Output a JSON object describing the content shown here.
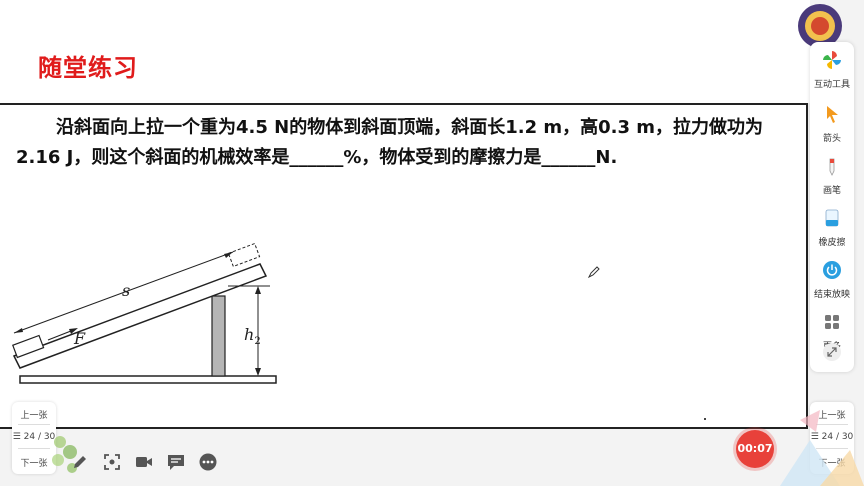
{
  "slide": {
    "title": "随堂练习",
    "problem_text": "沿斜面向上拉一个重为4.5 N的物体到斜面顶端，斜面长1.2 m，高0.3 m，拉力做功为2.16 J，则这个斜面的机械效率是______%，物体受到的摩擦力是______N.",
    "diagram": {
      "label_s": "s",
      "label_F": "F",
      "label_h": "h",
      "label_h_sub": "2"
    }
  },
  "toolbar": {
    "items": [
      {
        "label": "互动工具",
        "icon": "pinwheel-icon"
      },
      {
        "label": "箭头",
        "icon": "arrow-cursor-icon"
      },
      {
        "label": "画笔",
        "icon": "pen-icon"
      },
      {
        "label": "橡皮擦",
        "icon": "eraser-icon"
      },
      {
        "label": "结束放映",
        "icon": "power-icon"
      },
      {
        "label": "更多",
        "icon": "grid-icon"
      }
    ]
  },
  "nav_left": {
    "prev": "上一张",
    "page": "24 / 30",
    "next": "下一张"
  },
  "nav_right": {
    "prev": "上一张",
    "page": "24 / 30",
    "next": "下一张"
  },
  "timer": {
    "value": "00:07"
  },
  "colors": {
    "title_red": "#e01b1b",
    "timer_red": "#e8413a",
    "accent_blue": "#2a9fe0"
  }
}
